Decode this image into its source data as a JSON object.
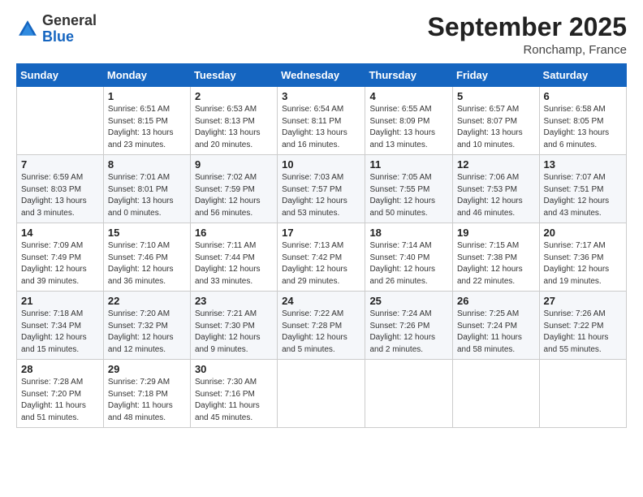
{
  "header": {
    "logo_line1": "General",
    "logo_line2": "Blue",
    "month": "September 2025",
    "location": "Ronchamp, France"
  },
  "weekdays": [
    "Sunday",
    "Monday",
    "Tuesday",
    "Wednesday",
    "Thursday",
    "Friday",
    "Saturday"
  ],
  "weeks": [
    [
      {
        "day": "",
        "info": ""
      },
      {
        "day": "1",
        "info": "Sunrise: 6:51 AM\nSunset: 8:15 PM\nDaylight: 13 hours\nand 23 minutes."
      },
      {
        "day": "2",
        "info": "Sunrise: 6:53 AM\nSunset: 8:13 PM\nDaylight: 13 hours\nand 20 minutes."
      },
      {
        "day": "3",
        "info": "Sunrise: 6:54 AM\nSunset: 8:11 PM\nDaylight: 13 hours\nand 16 minutes."
      },
      {
        "day": "4",
        "info": "Sunrise: 6:55 AM\nSunset: 8:09 PM\nDaylight: 13 hours\nand 13 minutes."
      },
      {
        "day": "5",
        "info": "Sunrise: 6:57 AM\nSunset: 8:07 PM\nDaylight: 13 hours\nand 10 minutes."
      },
      {
        "day": "6",
        "info": "Sunrise: 6:58 AM\nSunset: 8:05 PM\nDaylight: 13 hours\nand 6 minutes."
      }
    ],
    [
      {
        "day": "7",
        "info": "Sunrise: 6:59 AM\nSunset: 8:03 PM\nDaylight: 13 hours\nand 3 minutes."
      },
      {
        "day": "8",
        "info": "Sunrise: 7:01 AM\nSunset: 8:01 PM\nDaylight: 13 hours\nand 0 minutes."
      },
      {
        "day": "9",
        "info": "Sunrise: 7:02 AM\nSunset: 7:59 PM\nDaylight: 12 hours\nand 56 minutes."
      },
      {
        "day": "10",
        "info": "Sunrise: 7:03 AM\nSunset: 7:57 PM\nDaylight: 12 hours\nand 53 minutes."
      },
      {
        "day": "11",
        "info": "Sunrise: 7:05 AM\nSunset: 7:55 PM\nDaylight: 12 hours\nand 50 minutes."
      },
      {
        "day": "12",
        "info": "Sunrise: 7:06 AM\nSunset: 7:53 PM\nDaylight: 12 hours\nand 46 minutes."
      },
      {
        "day": "13",
        "info": "Sunrise: 7:07 AM\nSunset: 7:51 PM\nDaylight: 12 hours\nand 43 minutes."
      }
    ],
    [
      {
        "day": "14",
        "info": "Sunrise: 7:09 AM\nSunset: 7:49 PM\nDaylight: 12 hours\nand 39 minutes."
      },
      {
        "day": "15",
        "info": "Sunrise: 7:10 AM\nSunset: 7:46 PM\nDaylight: 12 hours\nand 36 minutes."
      },
      {
        "day": "16",
        "info": "Sunrise: 7:11 AM\nSunset: 7:44 PM\nDaylight: 12 hours\nand 33 minutes."
      },
      {
        "day": "17",
        "info": "Sunrise: 7:13 AM\nSunset: 7:42 PM\nDaylight: 12 hours\nand 29 minutes."
      },
      {
        "day": "18",
        "info": "Sunrise: 7:14 AM\nSunset: 7:40 PM\nDaylight: 12 hours\nand 26 minutes."
      },
      {
        "day": "19",
        "info": "Sunrise: 7:15 AM\nSunset: 7:38 PM\nDaylight: 12 hours\nand 22 minutes."
      },
      {
        "day": "20",
        "info": "Sunrise: 7:17 AM\nSunset: 7:36 PM\nDaylight: 12 hours\nand 19 minutes."
      }
    ],
    [
      {
        "day": "21",
        "info": "Sunrise: 7:18 AM\nSunset: 7:34 PM\nDaylight: 12 hours\nand 15 minutes."
      },
      {
        "day": "22",
        "info": "Sunrise: 7:20 AM\nSunset: 7:32 PM\nDaylight: 12 hours\nand 12 minutes."
      },
      {
        "day": "23",
        "info": "Sunrise: 7:21 AM\nSunset: 7:30 PM\nDaylight: 12 hours\nand 9 minutes."
      },
      {
        "day": "24",
        "info": "Sunrise: 7:22 AM\nSunset: 7:28 PM\nDaylight: 12 hours\nand 5 minutes."
      },
      {
        "day": "25",
        "info": "Sunrise: 7:24 AM\nSunset: 7:26 PM\nDaylight: 12 hours\nand 2 minutes."
      },
      {
        "day": "26",
        "info": "Sunrise: 7:25 AM\nSunset: 7:24 PM\nDaylight: 11 hours\nand 58 minutes."
      },
      {
        "day": "27",
        "info": "Sunrise: 7:26 AM\nSunset: 7:22 PM\nDaylight: 11 hours\nand 55 minutes."
      }
    ],
    [
      {
        "day": "28",
        "info": "Sunrise: 7:28 AM\nSunset: 7:20 PM\nDaylight: 11 hours\nand 51 minutes."
      },
      {
        "day": "29",
        "info": "Sunrise: 7:29 AM\nSunset: 7:18 PM\nDaylight: 11 hours\nand 48 minutes."
      },
      {
        "day": "30",
        "info": "Sunrise: 7:30 AM\nSunset: 7:16 PM\nDaylight: 11 hours\nand 45 minutes."
      },
      {
        "day": "",
        "info": ""
      },
      {
        "day": "",
        "info": ""
      },
      {
        "day": "",
        "info": ""
      },
      {
        "day": "",
        "info": ""
      }
    ]
  ]
}
